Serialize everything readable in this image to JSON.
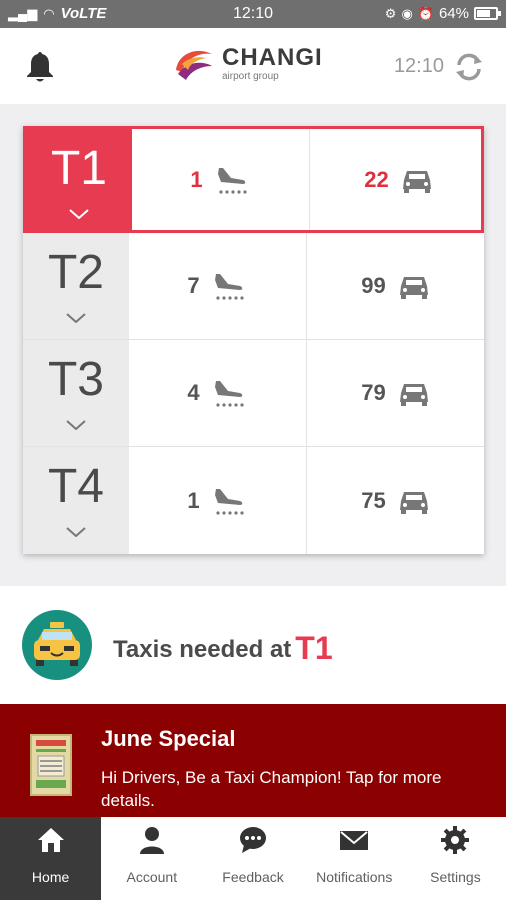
{
  "status_bar": {
    "time": "12:10",
    "network": "VoLTE",
    "battery": "64%",
    "battery_level": 0.64
  },
  "header": {
    "brand": "CHANGI",
    "brand_sub": "airport group",
    "time": "12:10",
    "icons": [
      "bell-icon",
      "refresh-icon"
    ]
  },
  "terminals": [
    {
      "name": "T1",
      "arrivals": "1",
      "taxis": "22",
      "active": true
    },
    {
      "name": "T2",
      "arrivals": "7",
      "taxis": "99",
      "active": false
    },
    {
      "name": "T3",
      "arrivals": "4",
      "taxis": "79",
      "active": false
    },
    {
      "name": "T4",
      "arrivals": "1",
      "taxis": "75",
      "active": false
    }
  ],
  "needed": {
    "label": "Taxis needed at",
    "terminal": "T1"
  },
  "promo": {
    "title": "June Special",
    "body": "Hi Drivers, Be a Taxi Champion! Tap for more details."
  },
  "nav": [
    {
      "label": "Home",
      "icon": "home-icon",
      "active": true
    },
    {
      "label": "Account",
      "icon": "person-icon",
      "active": false
    },
    {
      "label": "Feedback",
      "icon": "chat-icon",
      "active": false
    },
    {
      "label": "Notifications",
      "icon": "mail-icon",
      "active": false
    },
    {
      "label": "Settings",
      "icon": "gear-icon",
      "active": false
    }
  ],
  "colors": {
    "accent": "#e63b50",
    "promo_bg": "#8b0000",
    "nav_active": "#3a3a3a"
  }
}
